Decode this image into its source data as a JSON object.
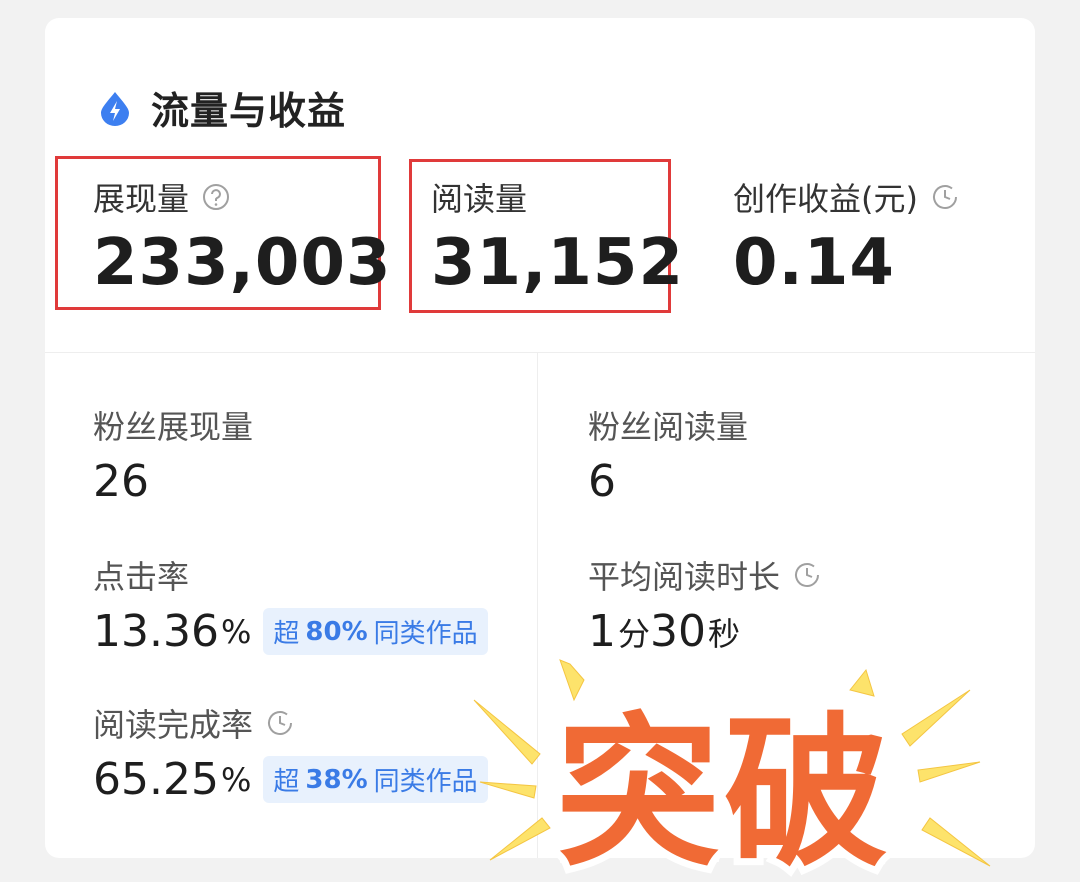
{
  "header": {
    "title": "流量与收益",
    "icon": "lightning-drop-icon",
    "icon_color": "#3d7ff0"
  },
  "top_metrics": [
    {
      "label": "展现量",
      "value": "233,003",
      "icon": "help-circle-icon",
      "highlighted": true
    },
    {
      "label": "阅读量",
      "value": "31,152",
      "icon": null,
      "highlighted": true
    },
    {
      "label": "创作收益(元)",
      "value": "0.14",
      "icon": "clock-icon",
      "highlighted": false
    }
  ],
  "stats": {
    "fan_impressions": {
      "label": "粉丝展现量",
      "value": "26"
    },
    "fan_reads": {
      "label": "粉丝阅读量",
      "value": "6"
    },
    "ctr": {
      "label": "点击率",
      "value": "13.36",
      "unit": "%",
      "badge": {
        "prefix": "超",
        "pct": "80%",
        "suffix": "同类作品"
      }
    },
    "avg_read_time": {
      "label": "平均阅读时长",
      "icon": "clock-icon",
      "minutes": "1",
      "min_unit": "分",
      "seconds": "30",
      "sec_unit": "秒"
    },
    "completion": {
      "label": "阅读完成率",
      "icon": "clock-icon",
      "value": "65.25",
      "unit": "%",
      "badge": {
        "prefix": "超",
        "pct": "38%",
        "suffix": "同类作品"
      }
    }
  },
  "sticker": {
    "text": "突破",
    "fill_color": "#f06a35",
    "outline_color": "#ffffff",
    "ray_color": "#fde36b"
  },
  "colors": {
    "highlight_border": "#e03a3a",
    "badge_text": "#3a7be6",
    "badge_bg": "#e8f1fd"
  }
}
